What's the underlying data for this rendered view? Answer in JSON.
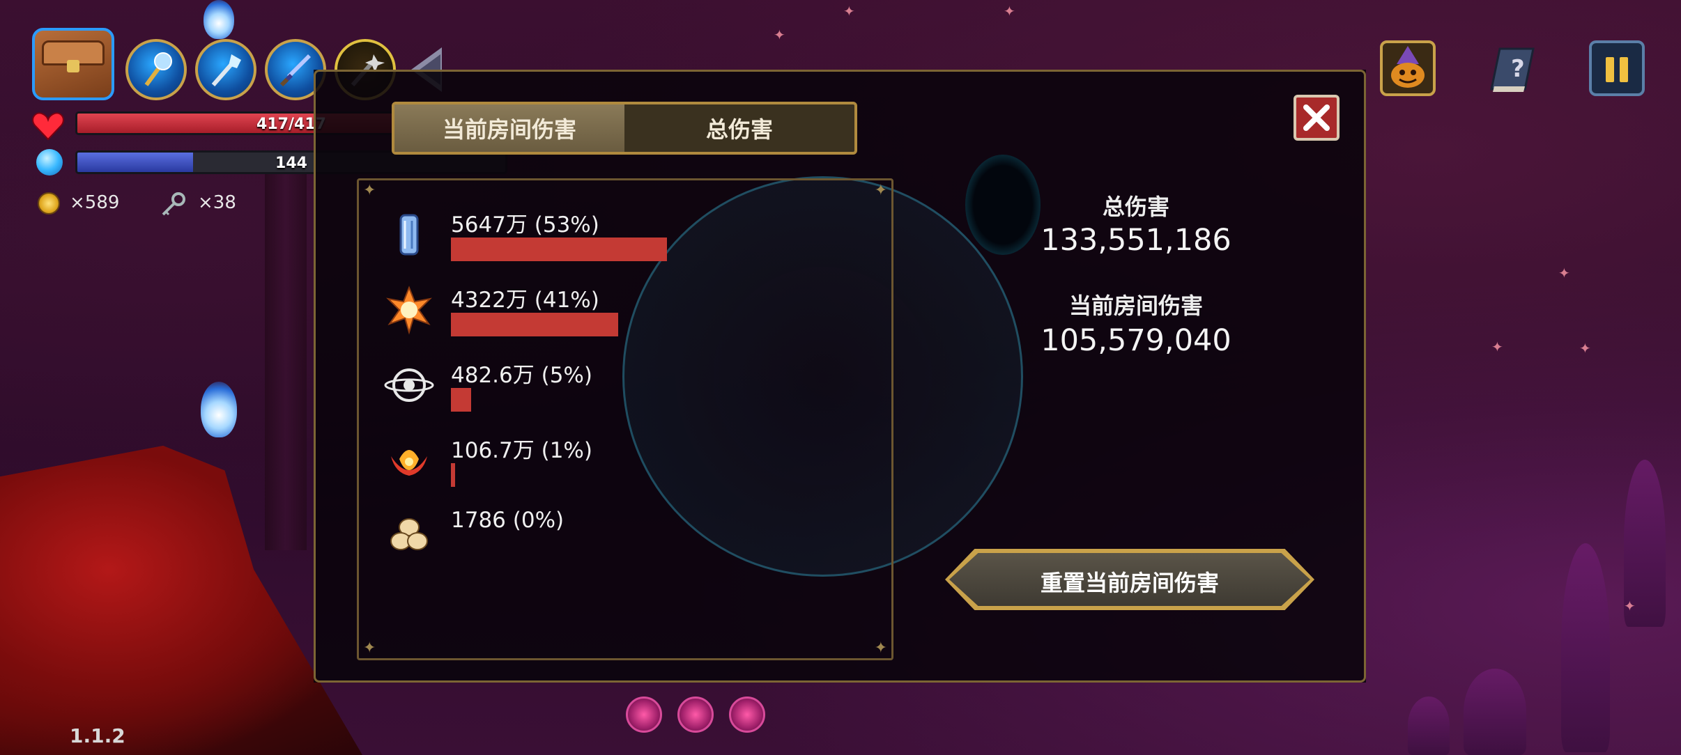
{
  "hud": {
    "health_text": "417/417",
    "health_fraction": 1.0,
    "mana_text": "144",
    "mana_fraction": 0.27,
    "gold_count": "×589",
    "key_count": "×38",
    "weapon_slots": [
      "staff-orb-icon",
      "ice-staff-icon",
      "sword-icon",
      "dark-staff-icon"
    ]
  },
  "modal": {
    "tabs": [
      {
        "label": "当前房间伤害",
        "active": true
      },
      {
        "label": "总伤害",
        "active": false
      }
    ],
    "damage_rows": [
      {
        "label": "5647万 (53%)",
        "percent": 53,
        "icon": "crystal-pillar-icon"
      },
      {
        "label": "4322万 (41%)",
        "percent": 41,
        "icon": "fire-burst-icon"
      },
      {
        "label": "482.6万 (5%)",
        "percent": 5,
        "icon": "ring-eye-icon"
      },
      {
        "label": "106.7万 (1%)",
        "percent": 1,
        "icon": "flame-crown-icon"
      },
      {
        "label": "1786 (0%)",
        "percent": 0,
        "icon": "bone-cluster-icon"
      }
    ],
    "total_damage_title": "总伤害",
    "total_damage_value": "133,551,186",
    "room_damage_title": "当前房间伤害",
    "room_damage_value": "105,579,040",
    "reset_button_label": "重置当前房间伤害"
  },
  "footer": {
    "version": "1.1.2"
  },
  "colors": {
    "health": "#c8303a",
    "mana": "#3e55c8",
    "damage_bar": "#c43a34",
    "gold_trim": "#c9a24a"
  }
}
